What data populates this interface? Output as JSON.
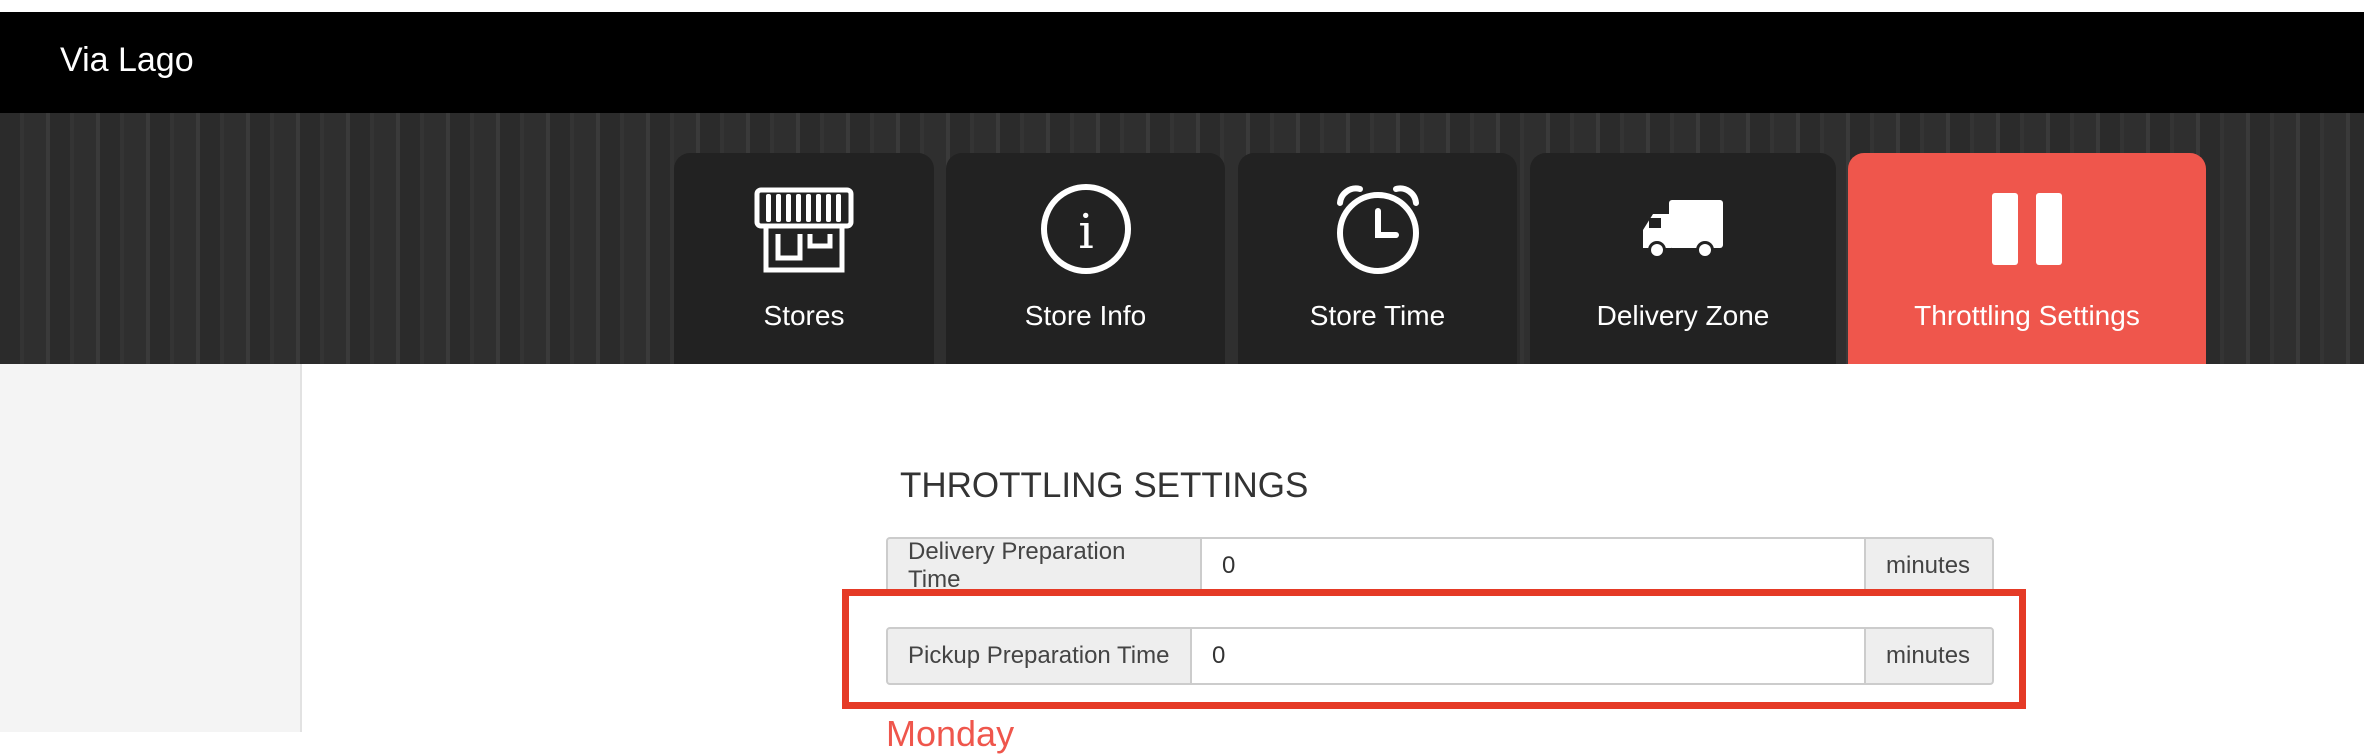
{
  "header": {
    "brand": "Via Lago"
  },
  "tabs": [
    {
      "label": "Stores",
      "icon": "storefront-icon",
      "active": false
    },
    {
      "label": "Store Info",
      "icon": "info-icon",
      "active": false
    },
    {
      "label": "Store Time",
      "icon": "alarm-clock-icon",
      "active": false
    },
    {
      "label": "Delivery Zone",
      "icon": "delivery-truck-icon",
      "active": false
    },
    {
      "label": "Throttling Settings",
      "icon": "pause-icon",
      "active": true
    }
  ],
  "main": {
    "section_title": "THROTTLING SETTINGS",
    "delivery_prep": {
      "label": "Delivery Preparation Time",
      "value": "0",
      "unit": "minutes"
    },
    "pickup_prep": {
      "label": "Pickup Preparation Time",
      "value": "0",
      "unit": "minutes"
    },
    "day_label": "Monday"
  },
  "colors": {
    "accent": "#ef564c",
    "highlight_border": "#e53a26",
    "header_bg": "#000000",
    "tab_bg": "#222222"
  }
}
